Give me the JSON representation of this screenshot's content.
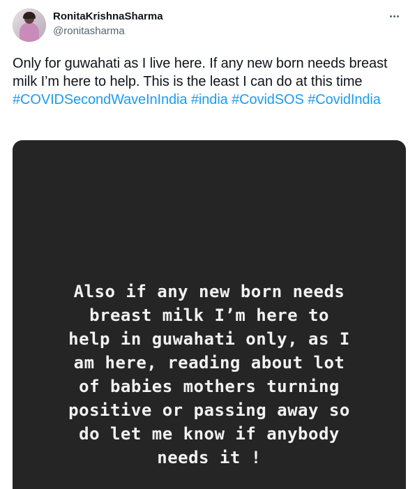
{
  "tweet": {
    "author": {
      "display_name": "RonitaKrishnaSharma",
      "handle": "@ronitasharma"
    },
    "more_icon": "more-horizontal-icon",
    "text_plain": "Only for guwahati as I live here. If any new born needs breast milk I’m here to help. This is the least I can do at this time",
    "hashtags": [
      "#COVIDSecondWaveInIndia",
      "#india",
      "#CovidSOS",
      "#CovidIndia"
    ],
    "colors": {
      "link": "#1d9bf0",
      "text": "#0f1419",
      "secondary": "#536471",
      "media_bg": "#252525"
    },
    "media": {
      "lines": [
        "Also if any new born needs",
        "breast milk I’m here to",
        "help in guwahati only, as I",
        "am here, reading about lot",
        "of babies mothers turning",
        "positive or passing away so",
        "do let me know if anybody",
        "needs it !"
      ]
    }
  }
}
